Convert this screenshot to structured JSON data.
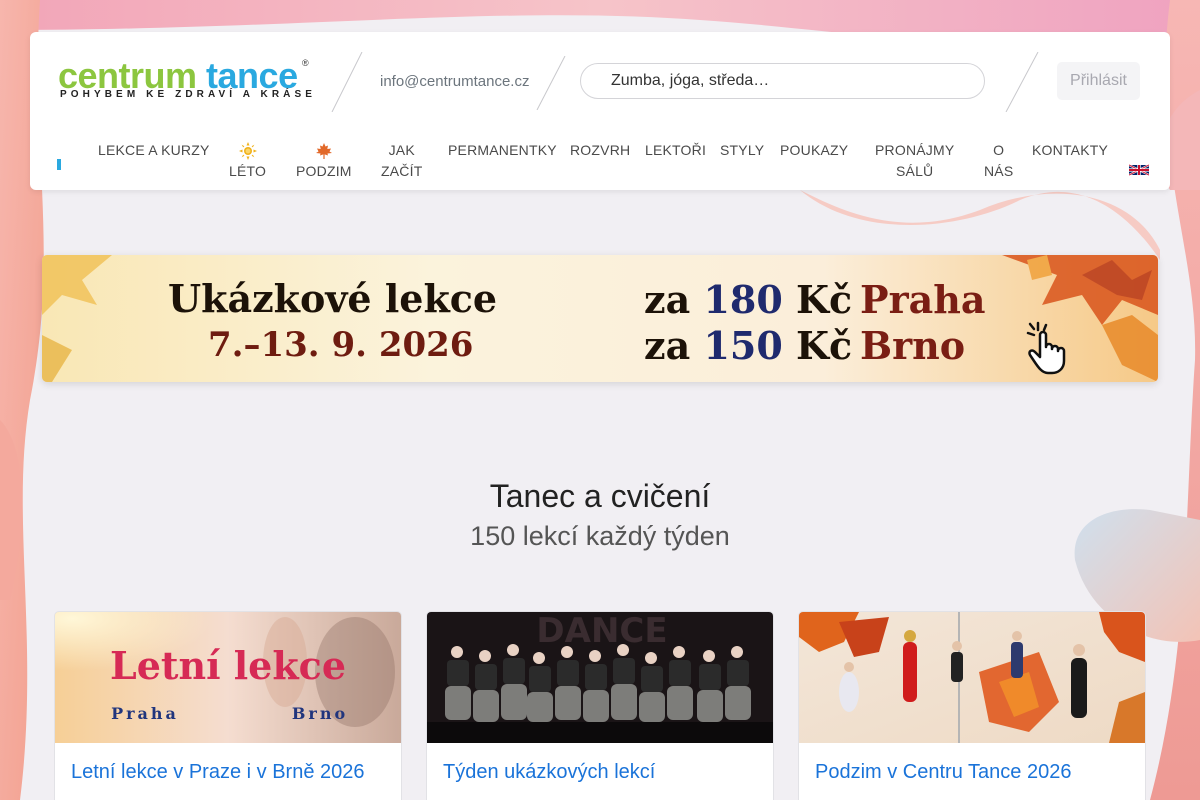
{
  "logo": {
    "word1": "centrum",
    "word2": "tance",
    "registered": "®",
    "tagline": "POHYBEM KE ZDRAVÍ A KRÁSE"
  },
  "header": {
    "email": "info@centrumtance.cz",
    "search_placeholder": "Zumba, jóga, středa…",
    "login_label": "Přihlásit"
  },
  "nav": {
    "items": [
      {
        "label": "LEKCE A KURZY"
      },
      {
        "label": "LÉTO",
        "icon": "sun-icon"
      },
      {
        "label": "PODZIM",
        "icon": "maple-leaf-icon"
      },
      {
        "label1": "JAK",
        "label2": "ZAČÍT"
      },
      {
        "label": "PERMANENTKY"
      },
      {
        "label": "ROZVRH"
      },
      {
        "label": "LEKTOŘI"
      },
      {
        "label": "STYLY"
      },
      {
        "label": "POUKAZY"
      },
      {
        "label1": "PRONÁJMY",
        "label2": "SÁLŮ"
      },
      {
        "label1": "O",
        "label2": "NÁS"
      },
      {
        "label": "KONTAKTY"
      }
    ],
    "language_flag": "uk-flag-icon"
  },
  "banner": {
    "title": "Ukázkové lekce",
    "dates": "7.–13. 9. 2026",
    "price1_prefix": "za ",
    "price1_value": "180",
    "price1_suffix": " Kč",
    "price2_prefix": "za ",
    "price2_value": "150",
    "price2_suffix": " Kč",
    "city1": "Praha",
    "city2": "Brno"
  },
  "section": {
    "title": "Tanec a cvičení",
    "subtitle": "150 lekcí každý týden"
  },
  "cards": [
    {
      "title": "Letní lekce v Praze i v Brně 2026",
      "img_title": "Letní lekce",
      "img_city1": "Praha",
      "img_city2": "Brno"
    },
    {
      "title": "Týden ukázkových lekcí",
      "img_text": "DANCE"
    },
    {
      "title": "Podzim v Centru Tance 2026"
    }
  ],
  "colors": {
    "brand_green": "#8cc63f",
    "brand_blue": "#2aa9e0",
    "link_blue": "#1a73d9"
  }
}
